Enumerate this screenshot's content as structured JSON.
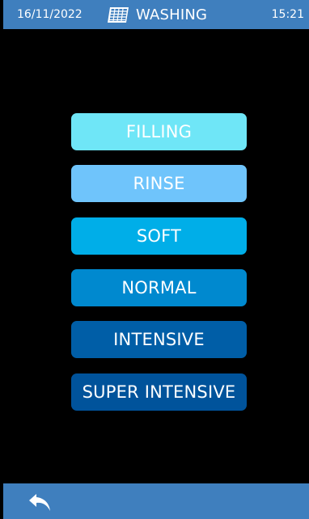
{
  "header": {
    "date": "16/11/2022",
    "title": "WASHING",
    "time": "15:21",
    "title_icon": "washer-rack-icon"
  },
  "programs": [
    {
      "label": "FILLING",
      "color": "#6fe6f7"
    },
    {
      "label": "RINSE",
      "color": "#6fc4fb"
    },
    {
      "label": "SOFT",
      "color": "#00aee8"
    },
    {
      "label": "NORMAL",
      "color": "#0089cf"
    },
    {
      "label": "INTENSIVE",
      "color": "#005ea7"
    },
    {
      "label": "SUPER INTENSIVE",
      "color": "#00539b"
    }
  ],
  "footer": {
    "back_icon": "back-arrow-icon"
  },
  "colors": {
    "bar": "#3f7fbe",
    "background": "#000000",
    "text": "#ffffff"
  }
}
